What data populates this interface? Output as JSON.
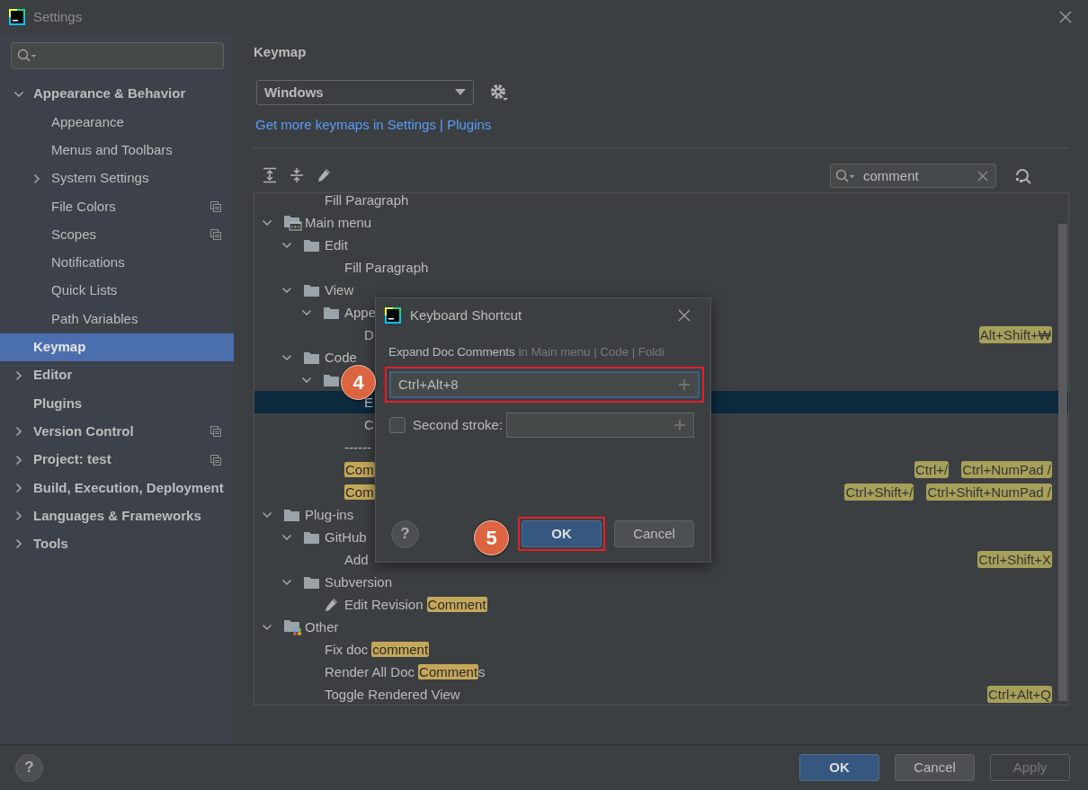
{
  "window": {
    "title": "Settings"
  },
  "sidebar": {
    "items": [
      {
        "label": "Appearance & Behavior",
        "expanded": true,
        "project_level": false,
        "selected": false,
        "children": [
          {
            "label": "Appearance",
            "project_level": false,
            "selected": false
          },
          {
            "label": "Menus and Toolbars",
            "project_level": false,
            "selected": false
          },
          {
            "label": "System Settings",
            "expanded": false,
            "project_level": false,
            "selected": false
          },
          {
            "label": "File Colors",
            "project_level": true,
            "selected": false
          },
          {
            "label": "Scopes",
            "project_level": true,
            "selected": false
          },
          {
            "label": "Notifications",
            "project_level": false,
            "selected": false
          },
          {
            "label": "Quick Lists",
            "project_level": false,
            "selected": false
          },
          {
            "label": "Path Variables",
            "project_level": false,
            "selected": false
          }
        ]
      },
      {
        "label": "Keymap",
        "project_level": false,
        "selected": true
      },
      {
        "label": "Editor",
        "expanded": false,
        "project_level": false,
        "selected": false
      },
      {
        "label": "Plugins",
        "project_level": false,
        "selected": false
      },
      {
        "label": "Version Control",
        "expanded": false,
        "project_level": true,
        "selected": false
      },
      {
        "label": "Project: test",
        "expanded": false,
        "project_level": true,
        "selected": false
      },
      {
        "label": "Build, Execution, Deployment",
        "expanded": false,
        "project_level": false,
        "selected": false
      },
      {
        "label": "Languages & Frameworks",
        "expanded": false,
        "project_level": false,
        "selected": false
      },
      {
        "label": "Tools",
        "expanded": false,
        "project_level": false,
        "selected": false
      }
    ]
  },
  "keymap": {
    "heading": "Keymap",
    "scheme": "Windows",
    "link": "Get more keymaps in Settings | Plugins",
    "search": {
      "value": "comment"
    },
    "tree": [
      {
        "children": [
          {
            "label": "Fill Paragraph",
            "selected": false
          }
        ]
      },
      {
        "label": "Main menu",
        "kind": "menu",
        "expanded": true,
        "selected": false,
        "children": [
          {
            "label": "Edit",
            "kind": "folder",
            "expanded": true,
            "selected": false,
            "children": [
              {
                "label": "Fill Paragraph",
                "selected": false
              }
            ]
          },
          {
            "label": "View",
            "kind": "folder",
            "expanded": true,
            "selected": false,
            "children": [
              {
                "label": "Appe",
                "kind": "folder",
                "expanded": true,
                "selected": false,
                "children": [
                  {
                    "label": "D",
                    "selected": false,
                    "shortcuts": [
                      "Alt+Shift+₩"
                    ]
                  }
                ]
              }
            ]
          },
          {
            "label": "Code",
            "kind": "folder",
            "expanded": true,
            "selected": false,
            "children": [
              {
                "kind": "folder",
                "expanded": true,
                "selected": false,
                "children": [
                  {
                    "label": "E",
                    "selected": true
                  },
                  {
                    "label": "C",
                    "selected": false
                  }
                ]
              },
              {
                "label": "------",
                "selected": false
              },
              {
                "match": "Com",
                "selected": false,
                "shortcuts": [
                  "Ctrl+/",
                  "Ctrl+NumPad /"
                ]
              },
              {
                "match": "Com",
                "selected": false,
                "shortcuts": [
                  "Ctrl+Shift+/",
                  "Ctrl+Shift+NumPad /"
                ]
              }
            ]
          }
        ]
      },
      {
        "label": "Plug-ins",
        "kind": "folder",
        "expanded": true,
        "selected": false,
        "children": [
          {
            "label": "GitHub",
            "kind": "folder",
            "expanded": true,
            "selected": false,
            "children": [
              {
                "label": "Add",
                "selected": false,
                "shortcuts": [
                  "Ctrl+Shift+X"
                ]
              }
            ]
          },
          {
            "label": "Subversion",
            "kind": "folder",
            "expanded": true,
            "selected": false,
            "children": [
              {
                "label": "Edit Revision",
                "kind": "editable",
                "match": "Comment",
                "selected": false
              }
            ]
          }
        ]
      },
      {
        "label": "Other",
        "kind": "other",
        "expanded": true,
        "selected": false,
        "children": [
          {
            "label": "Fix doc",
            "match": "comment",
            "selected": false
          },
          {
            "label": "Render All Doc",
            "match": "Comment",
            "after": "s",
            "selected": false
          },
          {
            "label": "Toggle Rendered View",
            "selected": false,
            "shortcuts": [
              "Ctrl+Alt+Q"
            ]
          }
        ]
      }
    ]
  },
  "dialog": {
    "title": "Keyboard Shortcut",
    "action": "Expand Doc Comments",
    "path": "in Main menu | Code | Foldi",
    "first_stroke": {
      "value": "Ctrl+Alt+8",
      "focused": true,
      "step": "4"
    },
    "second_stroke": {
      "label": "Second stroke:",
      "checked": false,
      "focused": false
    },
    "help": "?",
    "buttons": [
      {
        "label": "OK",
        "kind": "primary",
        "step": "5"
      },
      {
        "label": "Cancel",
        "kind": "default"
      }
    ]
  },
  "footer": {
    "help": "?",
    "buttons": [
      {
        "label": "OK",
        "kind": "primary",
        "disabled": false
      },
      {
        "label": "Cancel",
        "kind": "default",
        "disabled": false
      },
      {
        "label": "Apply",
        "kind": "default",
        "disabled": true
      }
    ]
  }
}
